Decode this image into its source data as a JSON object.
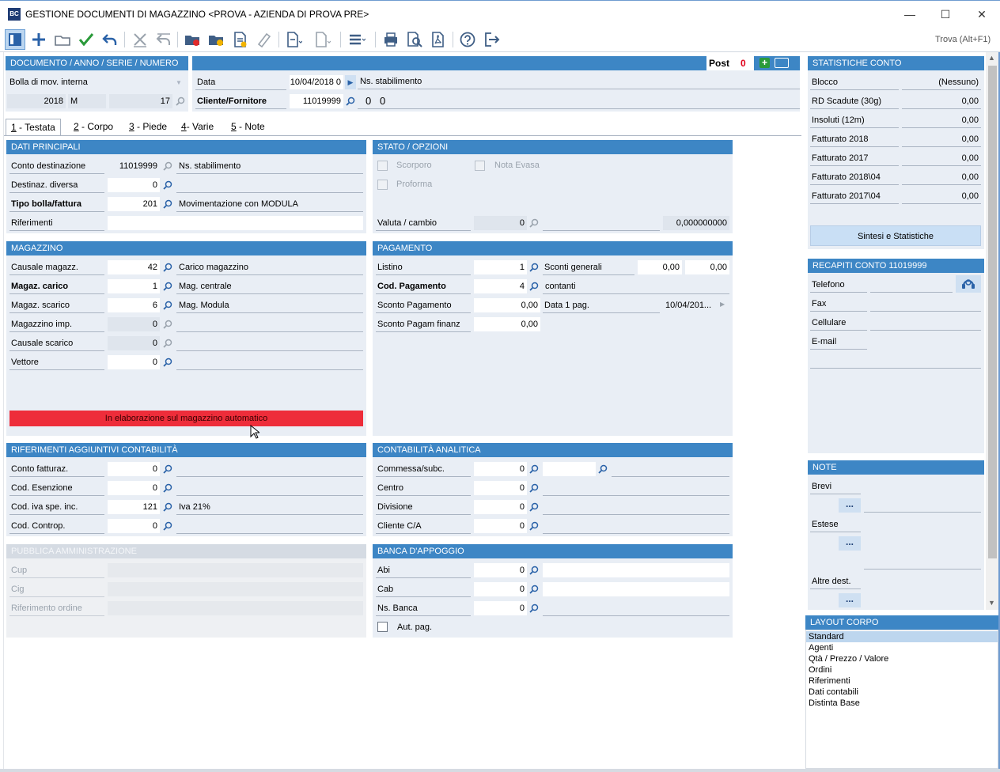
{
  "window": {
    "title": "GESTIONE DOCUMENTI DI MAGAZZINO <PROVA - AZIENDA DI PROVA PRE>",
    "app_icon_text": "BC",
    "minimize": "—",
    "maximize": "☐",
    "close": "✕"
  },
  "toolbar": {
    "find_label": "Trova (Alt+F1)",
    "icons": [
      "panel-icon",
      "add-icon",
      "open-folder-icon",
      "confirm-check-icon",
      "undo-icon",
      "delete-icon",
      "revert-icon",
      "folder-red-icon",
      "folder-yellow-icon",
      "document-edit-icon",
      "eraser-icon",
      "new-document-icon",
      "document-icon",
      "menu-icon",
      "print-icon",
      "print-preview-icon",
      "pdf-icon",
      "help-icon",
      "exit-icon"
    ]
  },
  "header": {
    "doc_title": "DOCUMENTO / ANNO / SERIE / NUMERO",
    "doc_type": "Bolla di mov. interna",
    "anno": "2018",
    "serie": "M",
    "numero": "17",
    "post_label": "Post",
    "post_value": "0",
    "data_label": "Data",
    "data_value": "10/04/2018 0",
    "ns_stab_label": "Ns. stabilimento",
    "cliente_label": "Cliente/Fornitore",
    "cliente_value": "11019999",
    "extra_1": "0",
    "extra_2": "0"
  },
  "tabs": [
    {
      "key": "1",
      "label": " - Testata"
    },
    {
      "key": "2",
      "label": " - Corpo"
    },
    {
      "key": "3",
      "label": " - Piede"
    },
    {
      "key": "4",
      "label": "- Varie"
    },
    {
      "key": "5",
      "label": " - Note"
    }
  ],
  "dati_principali": {
    "title": "DATI PRINCIPALI",
    "rows": [
      {
        "label": "Conto destinazione",
        "value": "11019999",
        "desc": "Ns. stabilimento"
      },
      {
        "label": "Destinaz. diversa",
        "value": "0",
        "desc": ""
      },
      {
        "label": "Tipo bolla/fattura",
        "value": "201",
        "desc": "Movimentazione con MODULA"
      },
      {
        "label": "Riferimenti",
        "value": "",
        "desc": ""
      }
    ]
  },
  "stato_opzioni": {
    "title": "STATO / OPZIONI",
    "scorporo": "Scorporo",
    "nota_evasa": "Nota Evasa",
    "proforma": "Proforma",
    "valuta_label": "Valuta / cambio",
    "valuta_value": "0",
    "cambio_value": "0,000000000"
  },
  "magazzino": {
    "title": "MAGAZZINO",
    "rows": [
      {
        "label": "Causale magazz.",
        "value": "42",
        "desc": "Carico magazzino"
      },
      {
        "label": "Magaz. carico",
        "value": "1",
        "desc": "Mag. centrale"
      },
      {
        "label": "Magaz. scarico",
        "value": "6",
        "desc": "Mag. Modula"
      },
      {
        "label": "Magazzino imp.",
        "value": "0",
        "desc": ""
      },
      {
        "label": "Causale scarico",
        "value": "0",
        "desc": ""
      },
      {
        "label": "Vettore",
        "value": "0",
        "desc": ""
      }
    ],
    "status_bar": "In elaborazione sul magazzino automatico"
  },
  "pagamento": {
    "title": "PAGAMENTO",
    "listino_label": "Listino",
    "listino_value": "1",
    "sconti_label": "Sconti generali",
    "sconto1": "0,00",
    "sconto2": "0,00",
    "cod_pag_label": "Cod. Pagamento",
    "cod_pag_value": "4",
    "cod_pag_desc": "contanti",
    "sconto_pag_label": "Sconto Pagamento",
    "sconto_pag_value": "0,00",
    "data_pag_label": "Data 1 pag.",
    "data_pag_value": "10/04/201...",
    "sconto_fin_label": "Sconto Pagam finanz",
    "sconto_fin_value": "0,00"
  },
  "rif_contabilita": {
    "title": "RIFERIMENTI AGGIUNTIVI CONTABILITÀ",
    "rows": [
      {
        "label": "Conto fatturaz.",
        "value": "0",
        "desc": ""
      },
      {
        "label": "Cod. Esenzione",
        "value": "0",
        "desc": ""
      },
      {
        "label": "Cod. iva spe. inc.",
        "value": "121",
        "desc": "Iva 21%"
      },
      {
        "label": "Cod. Controp.",
        "value": "0",
        "desc": ""
      }
    ]
  },
  "contabilita_analitica": {
    "title": "CONTABILITÀ ANALITICA",
    "rows": [
      {
        "label": "Commessa/subc.",
        "value": "0"
      },
      {
        "label": "Centro",
        "value": "0"
      },
      {
        "label": "Divisione",
        "value": "0"
      },
      {
        "label": "Cliente C/A",
        "value": "0"
      }
    ]
  },
  "pubblica_amm": {
    "title": "PUBBLICA AMMINISTRAZIONE",
    "rows": [
      "Cup",
      "Cig",
      "Riferimento ordine"
    ]
  },
  "banca": {
    "title": "BANCA D'APPOGGIO",
    "rows": [
      {
        "label": "Abi",
        "value": "0"
      },
      {
        "label": "Cab",
        "value": "0"
      },
      {
        "label": "Ns. Banca",
        "value": "0"
      }
    ],
    "aut_pag": "Aut. pag."
  },
  "statistiche": {
    "title": "STATISTICHE CONTO",
    "rows": [
      {
        "label": "Blocco",
        "value": "(Nessuno)"
      },
      {
        "label": "RD Scadute (30g)",
        "value": "0,00"
      },
      {
        "label": "Insoluti (12m)",
        "value": "0,00"
      },
      {
        "label": "Fatturato 2018",
        "value": "0,00"
      },
      {
        "label": "Fatturato 2017",
        "value": "0,00"
      },
      {
        "label": "Fatturato 2018\\04",
        "value": "0,00"
      },
      {
        "label": "Fatturato 2017\\04",
        "value": "0,00"
      }
    ],
    "sintesi_button": "Sintesi e Statistiche"
  },
  "recapiti": {
    "title": "RECAPITI CONTO 11019999",
    "rows": [
      "Telefono",
      "Fax",
      "Cellulare",
      "E-mail"
    ]
  },
  "note": {
    "title": "NOTE",
    "brevi": "Brevi",
    "estese": "Estese",
    "altre": "Altre dest.",
    "dots": "..."
  },
  "layout_corpo": {
    "title": "LAYOUT CORPO",
    "items": [
      "Standard",
      "Agenti",
      "Qtà / Prezzo / Valore",
      "Ordini",
      "Riferimenti",
      "Dati contabili",
      "Distinta Base"
    ]
  },
  "colors": {
    "section_header": "#3d86c5",
    "panel_bg": "#e9eef5",
    "alert_red": "#ee2d3a",
    "post_red": "#e0001a"
  }
}
